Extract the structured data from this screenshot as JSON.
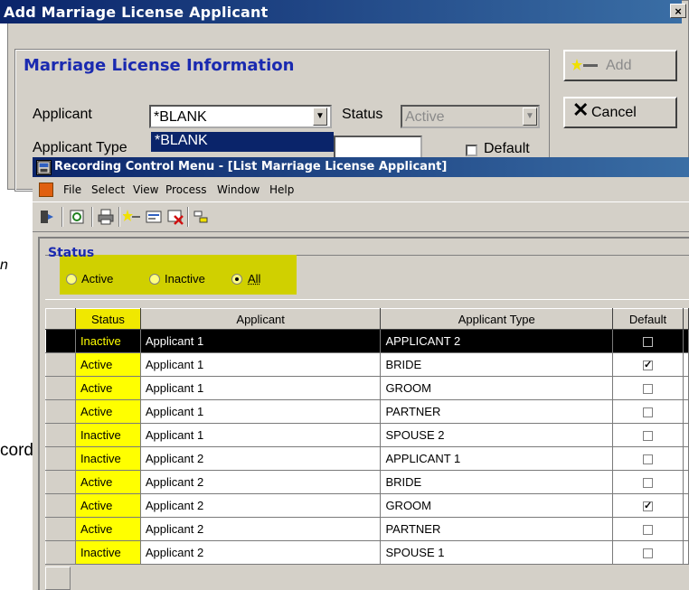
{
  "dialog": {
    "title": "Add Marriage License Applicant",
    "close_glyph": "×",
    "group_title": "Marriage License Information",
    "applicant_label": "Applicant",
    "applicant_value": "*BLANK",
    "dropdown_item": "*BLANK",
    "status_label": "Status",
    "status_value": "Active",
    "applicant_type_label": "Applicant Type",
    "default_label": "Default",
    "add_label": "Add",
    "cancel_label": "Cancel"
  },
  "fragments": {
    "left_n": "n",
    "left_cord": "cord"
  },
  "window": {
    "title": "Recording Control Menu - [List Marriage License Applicant]",
    "menu": [
      "File",
      "Select",
      "View",
      "Process",
      "Window",
      "Help"
    ]
  },
  "status_filter": {
    "title": "Status",
    "options": [
      "Active",
      "Inactive",
      "All"
    ],
    "selected": "All"
  },
  "grid": {
    "columns": [
      "Status",
      "Applicant",
      "Applicant Type",
      "Default"
    ],
    "rows": [
      {
        "status": "Inactive",
        "applicant": "Applicant 1",
        "type": "APPLICANT 2",
        "default": false,
        "selected": true
      },
      {
        "status": "Active",
        "applicant": "Applicant 1",
        "type": "BRIDE",
        "default": true
      },
      {
        "status": "Active",
        "applicant": "Applicant 1",
        "type": "GROOM",
        "default": false
      },
      {
        "status": "Active",
        "applicant": "Applicant 1",
        "type": "PARTNER",
        "default": false
      },
      {
        "status": "Inactive",
        "applicant": "Applicant 1",
        "type": "SPOUSE 2",
        "default": false
      },
      {
        "status": "Inactive",
        "applicant": "Applicant 2",
        "type": "APPLICANT 1",
        "default": false
      },
      {
        "status": "Active",
        "applicant": "Applicant 2",
        "type": "BRIDE",
        "default": false
      },
      {
        "status": "Active",
        "applicant": "Applicant 2",
        "type": "GROOM",
        "default": true
      },
      {
        "status": "Active",
        "applicant": "Applicant 2",
        "type": "PARTNER",
        "default": false
      },
      {
        "status": "Inactive",
        "applicant": "Applicant 2",
        "type": "SPOUSE 1",
        "default": false
      }
    ]
  },
  "colors": {
    "title_bar": "#0a246a",
    "group_title": "#1a2ab0",
    "highlight": "#ffff00",
    "radio_highlight": "#d0d000"
  },
  "icons": [
    "exit-icon",
    "refresh-icon",
    "print-icon",
    "add-icon",
    "edit-icon",
    "delete-icon",
    "sort-icon"
  ]
}
